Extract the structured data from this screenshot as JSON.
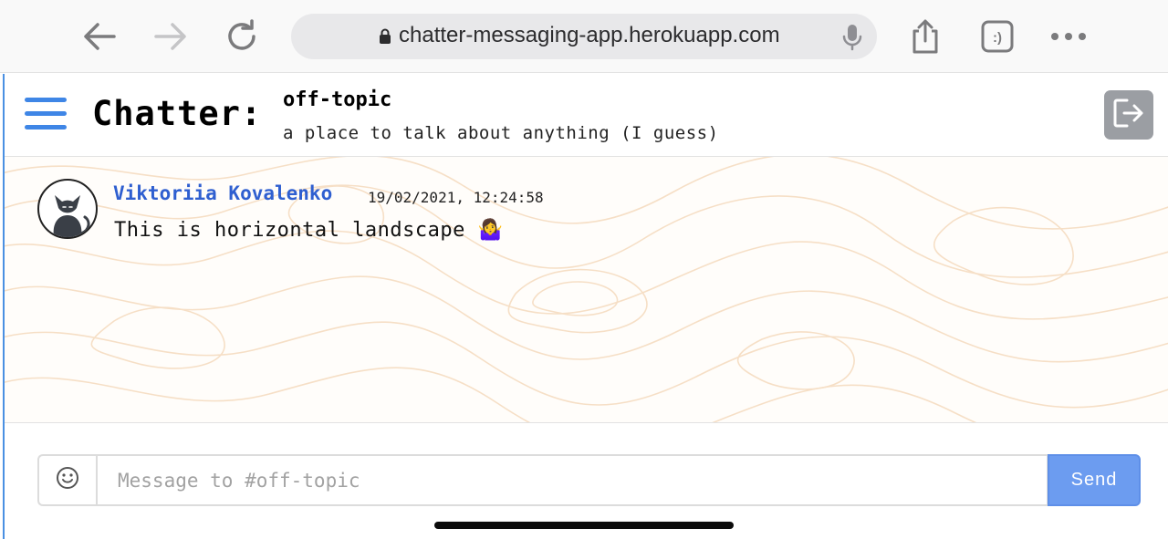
{
  "browser": {
    "url": "chatter-messaging-app.herokuapp.com",
    "tabs_label": ":)",
    "icons": [
      "back-arrow-icon",
      "forward-arrow-icon",
      "reload-icon",
      "lock-icon",
      "microphone-icon",
      "share-icon",
      "tabs-icon",
      "more-icon"
    ]
  },
  "app": {
    "title": "Chatter:",
    "channel_name": "off-topic",
    "channel_description": "a place to talk about anything (I guess)",
    "icons": [
      "hamburger-menu-icon",
      "logout-icon"
    ]
  },
  "messages": [
    {
      "author": "Viktoriia Kovalenko",
      "timestamp": "19/02/2021, 12:24:58",
      "text": "This is horizontal landscape 🤷‍♀️",
      "avatar_icon": "cat-avatar-icon"
    }
  ],
  "composer": {
    "placeholder": "Message to #off-topic",
    "value": "",
    "send_label": "Send",
    "emoji_icon": "smiley-icon"
  },
  "colors": {
    "accent": "#3f86e6",
    "author": "#2f5fd0",
    "send_button": "#6c9cf0",
    "logout_button": "#9b9ea3",
    "topo_lines": "#f5dcc0"
  }
}
